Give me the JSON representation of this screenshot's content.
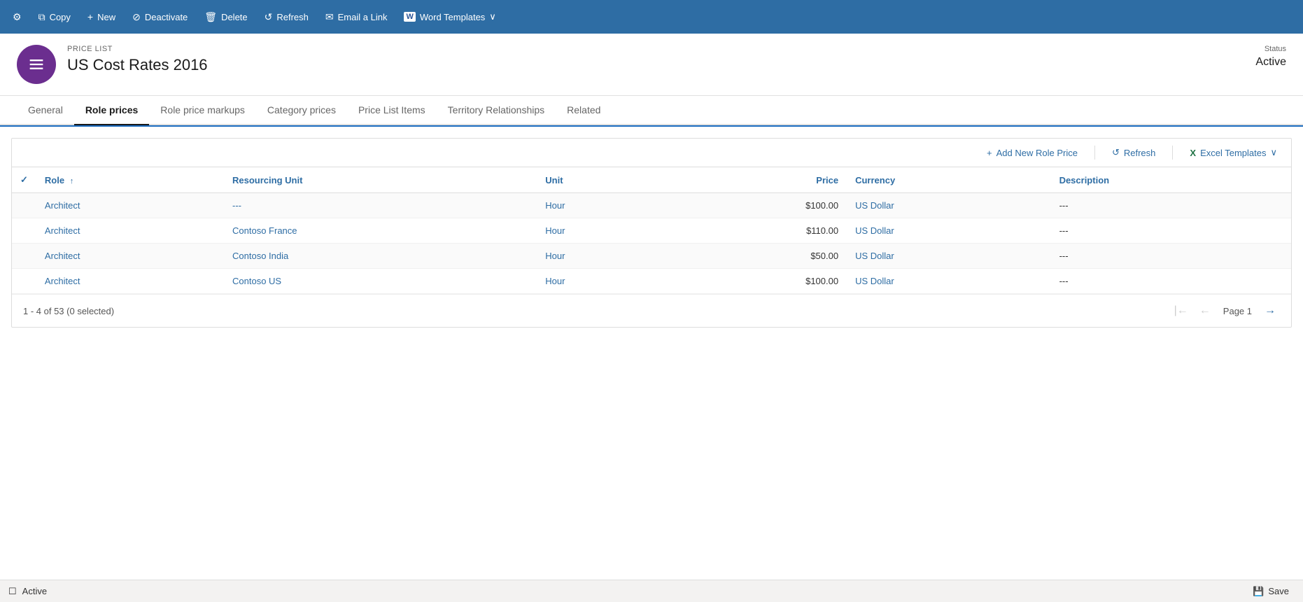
{
  "toolbar": {
    "buttons": [
      {
        "id": "copy",
        "label": "Copy",
        "icon": "⧉"
      },
      {
        "id": "new",
        "label": "New",
        "icon": "+"
      },
      {
        "id": "deactivate",
        "label": "Deactivate",
        "icon": "⊘"
      },
      {
        "id": "delete",
        "label": "Delete",
        "icon": "🗑"
      },
      {
        "id": "refresh",
        "label": "Refresh",
        "icon": "↺"
      },
      {
        "id": "email-link",
        "label": "Email a Link",
        "icon": "✉"
      },
      {
        "id": "word-templates",
        "label": "Word Templates",
        "icon": "W",
        "hasDropdown": true
      }
    ]
  },
  "record": {
    "type": "PRICE LIST",
    "name": "US Cost Rates 2016",
    "status_label": "Status",
    "status_value": "Active"
  },
  "tabs": [
    {
      "id": "general",
      "label": "General",
      "active": false
    },
    {
      "id": "role-prices",
      "label": "Role prices",
      "active": true
    },
    {
      "id": "role-price-markups",
      "label": "Role price markups",
      "active": false
    },
    {
      "id": "category-prices",
      "label": "Category prices",
      "active": false
    },
    {
      "id": "price-list-items",
      "label": "Price List Items",
      "active": false
    },
    {
      "id": "territory-relationships",
      "label": "Territory Relationships",
      "active": false
    },
    {
      "id": "related",
      "label": "Related",
      "active": false
    }
  ],
  "grid": {
    "toolbar": {
      "add_label": "Add New Role Price",
      "refresh_label": "Refresh",
      "excel_label": "Excel Templates"
    },
    "columns": [
      {
        "id": "role",
        "label": "Role",
        "sortable": true
      },
      {
        "id": "resourcing-unit",
        "label": "Resourcing Unit",
        "sortable": false
      },
      {
        "id": "unit",
        "label": "Unit",
        "sortable": false
      },
      {
        "id": "price",
        "label": "Price",
        "align": "right",
        "sortable": false
      },
      {
        "id": "currency",
        "label": "Currency",
        "sortable": false
      },
      {
        "id": "description",
        "label": "Description",
        "sortable": false
      }
    ],
    "rows": [
      {
        "role": "Architect",
        "resourcing_unit": "---",
        "unit": "Hour",
        "price": "$100.00",
        "currency": "US Dollar",
        "description": "---"
      },
      {
        "role": "Architect",
        "resourcing_unit": "Contoso France",
        "unit": "Hour",
        "price": "$110.00",
        "currency": "US Dollar",
        "description": "---"
      },
      {
        "role": "Architect",
        "resourcing_unit": "Contoso India",
        "unit": "Hour",
        "price": "$50.00",
        "currency": "US Dollar",
        "description": "---"
      },
      {
        "role": "Architect",
        "resourcing_unit": "Contoso US",
        "unit": "Hour",
        "price": "$100.00",
        "currency": "US Dollar",
        "description": "---"
      }
    ],
    "pagination": {
      "summary": "1 - 4 of 53 (0 selected)",
      "page_label": "Page 1"
    }
  },
  "statusbar": {
    "status": "Active",
    "save_label": "Save"
  }
}
